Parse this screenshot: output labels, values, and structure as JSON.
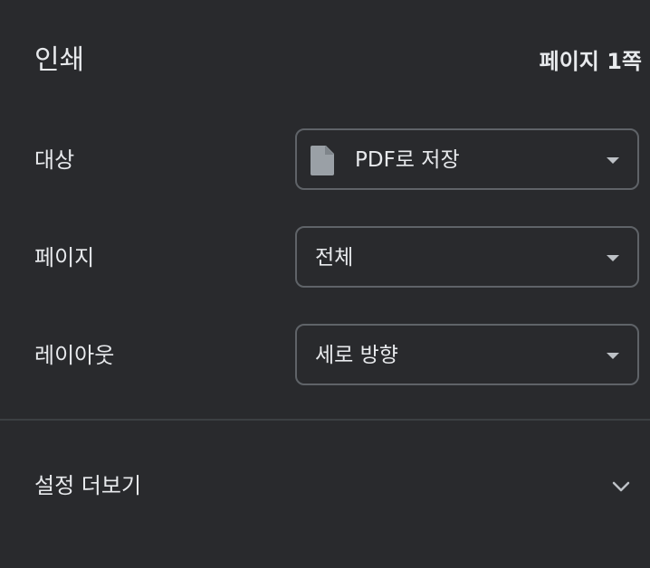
{
  "header": {
    "title": "인쇄",
    "page_count": "페이지 1쪽"
  },
  "settings": {
    "destination": {
      "label": "대상",
      "value": "PDF로 저장",
      "icon": "file-icon"
    },
    "pages": {
      "label": "페이지",
      "value": "전체"
    },
    "layout": {
      "label": "레이아웃",
      "value": "세로 방향"
    }
  },
  "more_settings": {
    "label": "설정 더보기",
    "icon": "chevron-down-icon"
  },
  "colors": {
    "background": "#292a2d",
    "text": "#e8eaed",
    "border": "#5f6368",
    "icon": "#9aa0a6"
  }
}
